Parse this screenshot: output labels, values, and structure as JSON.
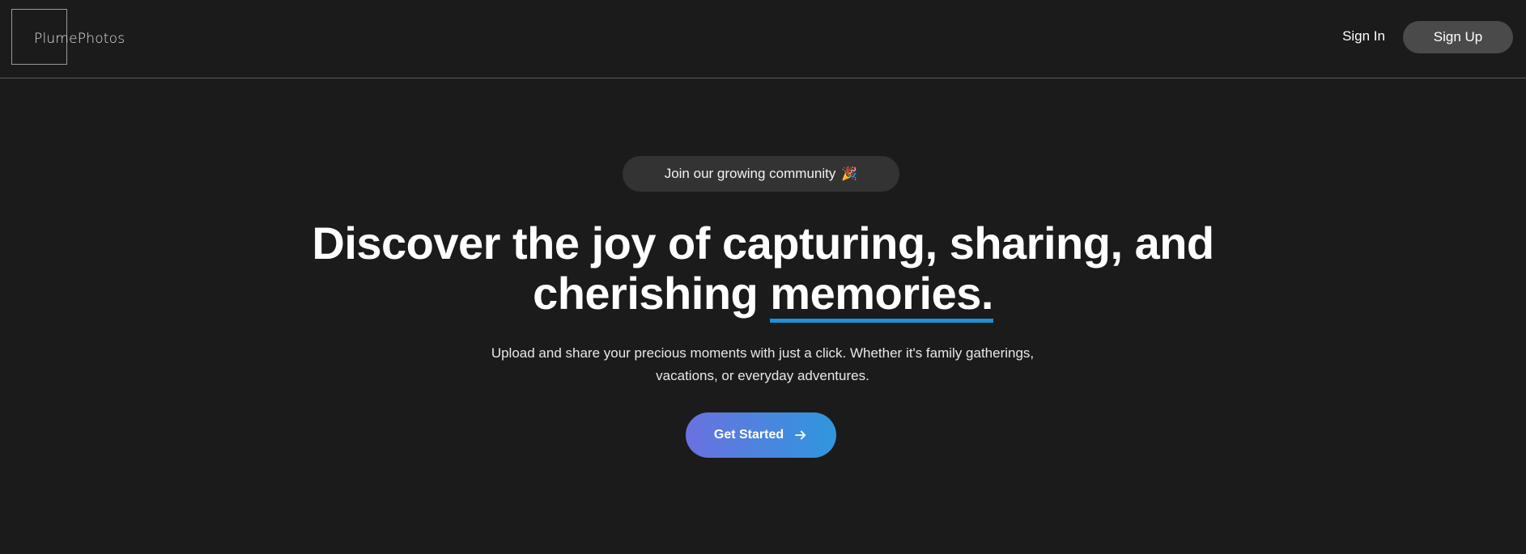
{
  "header": {
    "logo_text": "PlumePhotos",
    "signin_label": "Sign In",
    "signup_label": "Sign Up"
  },
  "hero": {
    "badge_text": "Join our growing community",
    "badge_icon": "party-popper-icon",
    "badge_emoji": "🎉",
    "headline_line1": "Discover the joy of capturing, sharing, and",
    "headline_line2_prefix": "cherishing ",
    "headline_highlight": "memories.",
    "subtext": "Upload and share your precious moments with just a click. Whether it's family gatherings, vacations, or everyday adventures.",
    "cta_label": "Get Started",
    "cta_icon": "arrow-right-icon"
  },
  "colors": {
    "background": "#1b1b1b",
    "underline_accent": "#1e90d6",
    "cta_gradient_start": "#6a71e0",
    "cta_gradient_end": "#2f97dd",
    "signup_bg": "#4a4a4a",
    "badge_bg": "#333333"
  }
}
